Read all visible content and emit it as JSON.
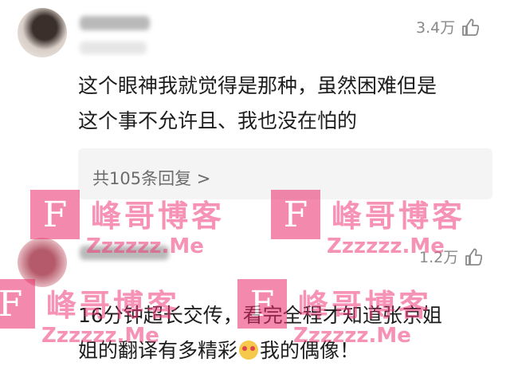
{
  "comments": [
    {
      "likes": "3.4万",
      "text_lines": [
        "这个眼神我就觉得是那种，虽然困难但是",
        "这个事不允许且、我也没在怕的"
      ],
      "replies_link": "共105条回复 >"
    },
    {
      "likes": "1.2万",
      "text_line1": "16分钟超长交传，看完全程才知道张京姐",
      "text_line2_before": "姐的翻译有多精彩",
      "text_line2_after": "我的偶像！"
    }
  ],
  "icons": {
    "like": "thumbs-up-icon",
    "emoji": "heart-eyes-emoji-icon"
  },
  "watermark": {
    "letter": "F",
    "brand": "峰哥博客",
    "url": "Zzzzzz.Me"
  },
  "colors": {
    "watermark": "#ef3a79",
    "text": "#1d1d1d",
    "meta": "#8a8a8a"
  }
}
